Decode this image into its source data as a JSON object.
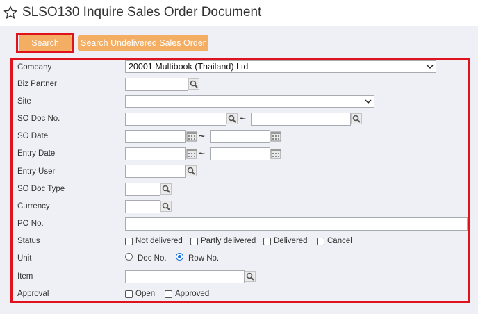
{
  "page": {
    "title": "SLSO130 Inquire Sales Order Document"
  },
  "buttons": {
    "search": "Search",
    "search_undelivered": "Search Undelivered Sales Order"
  },
  "form": {
    "company": {
      "label": "Company",
      "value": "20001 Multibook (Thailand) Ltd"
    },
    "biz_partner": {
      "label": "Biz Partner",
      "value": ""
    },
    "site": {
      "label": "Site",
      "value": ""
    },
    "so_doc_no": {
      "label": "SO Doc No.",
      "from": "",
      "to": "",
      "separator": "~"
    },
    "so_date": {
      "label": "SO Date",
      "from": "",
      "to": "",
      "separator": "~"
    },
    "entry_date": {
      "label": "Entry Date",
      "from": "",
      "to": "",
      "separator": "~"
    },
    "entry_user": {
      "label": "Entry User",
      "value": ""
    },
    "so_doc_type": {
      "label": "SO Doc Type",
      "value": ""
    },
    "currency": {
      "label": "Currency",
      "value": ""
    },
    "po_no": {
      "label": "PO No.",
      "value": ""
    },
    "status": {
      "label": "Status",
      "options": [
        {
          "label": "Not delivered",
          "checked": false
        },
        {
          "label": "Partly delivered",
          "checked": false
        },
        {
          "label": "Delivered",
          "checked": false
        },
        {
          "label": "Cancel",
          "checked": false
        }
      ]
    },
    "unit": {
      "label": "Unit",
      "options": [
        {
          "label": "Doc No.",
          "selected": false
        },
        {
          "label": "Row No.",
          "selected": true
        }
      ]
    },
    "item": {
      "label": "Item",
      "value": ""
    },
    "approval": {
      "label": "Approval",
      "options": [
        {
          "label": "Open",
          "checked": false
        },
        {
          "label": "Approved",
          "checked": false
        }
      ]
    }
  },
  "icons": {
    "favorite": "star-outline-icon",
    "lookup": "magnifier-icon",
    "calendar": "calendar-icon",
    "dropdown": "chevron-down-icon"
  },
  "colors": {
    "button_bg": "#f3ae63",
    "highlight_border": "#e0131c",
    "content_bg": "#eff0f6",
    "radio_selected": "#1a6fe0"
  }
}
